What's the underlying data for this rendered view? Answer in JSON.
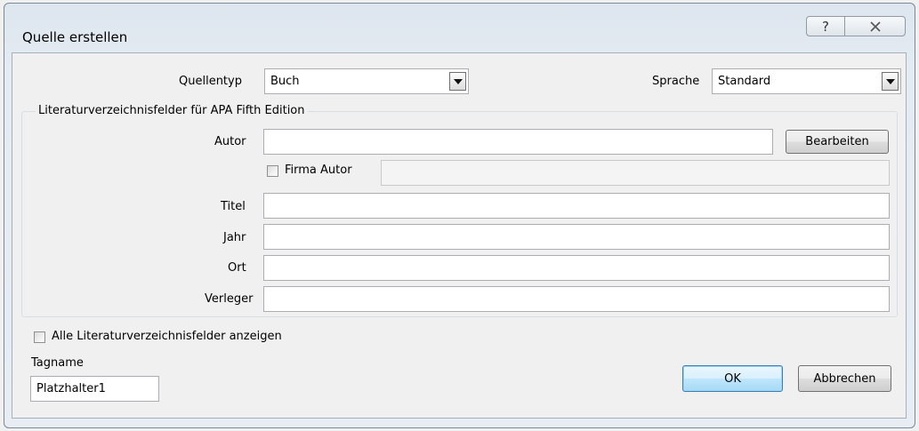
{
  "dialog": {
    "title": "Quelle erstellen",
    "help_glyph": "?",
    "close_glyph": "X"
  },
  "source_type": {
    "label": "Quellentyp",
    "value": "Buch"
  },
  "language": {
    "label": "Sprache",
    "value": "Standard"
  },
  "group": {
    "legend": "Literaturverzeichnisfelder für APA Fifth Edition",
    "author": {
      "label": "Autor",
      "value": "",
      "edit_button": "Bearbeiten"
    },
    "corporate_author": {
      "label": "Firma Autor",
      "checked": false,
      "value": ""
    },
    "title": {
      "label": "Titel",
      "value": ""
    },
    "year": {
      "label": "Jahr",
      "value": ""
    },
    "city": {
      "label": "Ort",
      "value": ""
    },
    "publisher": {
      "label": "Verleger",
      "value": ""
    }
  },
  "show_all": {
    "label": "Alle Literaturverzeichnisfelder anzeigen",
    "checked": false
  },
  "tag_name": {
    "label": "Tagname",
    "value": "Platzhalter1"
  },
  "buttons": {
    "ok": "OK",
    "cancel": "Abbrechen"
  }
}
